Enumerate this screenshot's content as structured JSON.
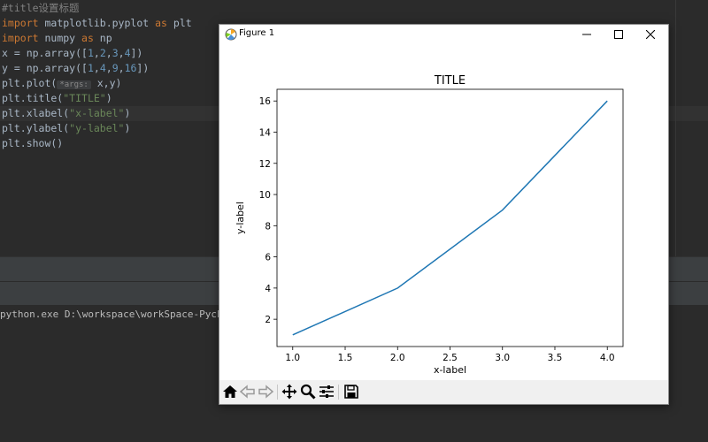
{
  "editor": {
    "comment": "#title设置标题",
    "lines": {
      "l2": {
        "kw1": "import",
        "mod": " matplotlib.pyplot ",
        "kw2": "as",
        "alias": " plt"
      },
      "l3": {
        "kw1": "import",
        "mod": " numpy ",
        "kw2": "as",
        "alias": " np"
      },
      "l4": {
        "pre": "x = np.array([",
        "n1": "1",
        "c1": ",",
        "n2": "2",
        "c2": ",",
        "n3": "3",
        "c3": ",",
        "n4": "4",
        "post": "])"
      },
      "l5": {
        "pre": "y = np.array([",
        "n1": "1",
        "c1": ",",
        "n2": "4",
        "c2": ",",
        "n3": "9",
        "c3": ",",
        "n4": "16",
        "post": "])"
      },
      "l6": {
        "pre": "plt.plot(",
        "hint": "*args:",
        "post": " x,y)"
      },
      "l7": {
        "pre": "plt.title(",
        "s": "\"TITLE\"",
        "post": ")"
      },
      "l8": {
        "pre": "plt.xlabel(",
        "s": "\"x-label\"",
        "post": ")"
      },
      "l9": {
        "pre": "plt.ylabel(",
        "s": "\"y-label\"",
        "post": ")"
      },
      "l10": {
        "pre": "plt.show()"
      }
    }
  },
  "console": {
    "text": "python.exe D:\\workspace\\workSpace-Pycha"
  },
  "figure": {
    "window_title": "Figure 1",
    "buttons": {
      "minimize": "—",
      "maximize": "☐",
      "close": "✕"
    },
    "toolbar_icons": [
      "home-icon",
      "back-icon",
      "forward-icon",
      "pan-icon",
      "zoom-icon",
      "configure-icon",
      "save-icon"
    ]
  },
  "chart_data": {
    "type": "line",
    "title": "TITLE",
    "xlabel": "x-label",
    "ylabel": "y-label",
    "x": [
      1,
      2,
      3,
      4
    ],
    "series": [
      {
        "values": [
          1,
          4,
          9,
          16
        ]
      }
    ],
    "xlim": [
      0.85,
      4.15
    ],
    "ylim": [
      0.25,
      16.75
    ],
    "xticks": [
      "1.0",
      "1.5",
      "2.0",
      "2.5",
      "3.0",
      "3.5",
      "4.0"
    ],
    "xtick_values": [
      1.0,
      1.5,
      2.0,
      2.5,
      3.0,
      3.5,
      4.0
    ],
    "yticks": [
      "2",
      "4",
      "6",
      "8",
      "10",
      "12",
      "14",
      "16"
    ],
    "ytick_values": [
      2,
      4,
      6,
      8,
      10,
      12,
      14,
      16
    ],
    "grid": false,
    "line_color": "#1f77b4"
  }
}
